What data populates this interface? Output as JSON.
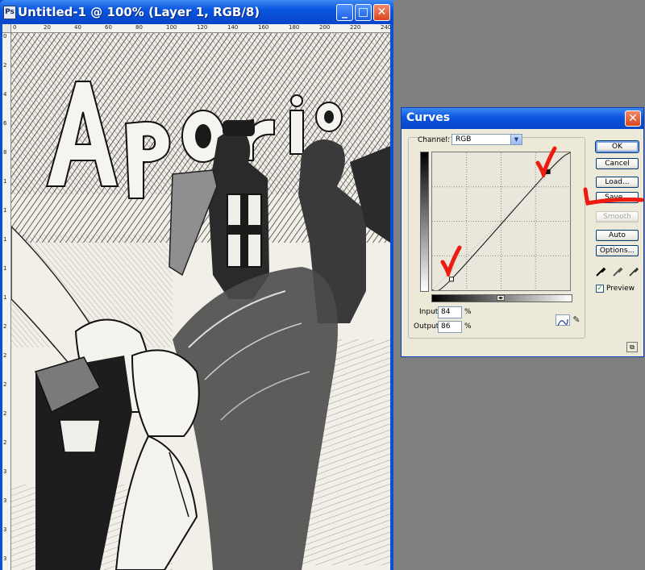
{
  "document_window": {
    "title": "Untitled-1 @ 100% (Layer 1, RGB/8)",
    "app_icon": "photoshop-icon",
    "controls": {
      "minimize": "_",
      "maximize": "□",
      "close": "✕"
    },
    "ruler_top_labels": [
      "0",
      "20",
      "40",
      "60",
      "80",
      "100",
      "120",
      "140",
      "160",
      "180",
      "200",
      "220",
      "240"
    ],
    "ruler_left_labels": [
      "0",
      "2",
      "4",
      "6",
      "8",
      "1",
      "1",
      "1",
      "1",
      "1",
      "2",
      "2",
      "2",
      "2",
      "2",
      "3",
      "3",
      "3",
      "3"
    ],
    "artwork": {
      "title_text": "Aporia",
      "description_icon": "artwork-image"
    }
  },
  "curves_dialog": {
    "title": "Curves",
    "channel_label": "Channel:",
    "channel_value": "RGB",
    "input_label": "Input:",
    "input_value": "84",
    "output_label": "Output:",
    "output_value": "86",
    "percent": "%",
    "buttons": {
      "ok": "OK",
      "cancel": "Cancel",
      "load": "Load...",
      "save": "Save...",
      "smooth": "Smooth",
      "auto": "Auto",
      "options": "Options..."
    },
    "preview_label": "Preview",
    "preview_checked": true,
    "curve_points": [
      [
        0,
        0
      ],
      [
        14,
        8
      ],
      [
        84,
        86
      ],
      [
        100,
        100
      ]
    ],
    "accent_color": "#0a55e0",
    "annotation_color": "#ee1b10"
  }
}
